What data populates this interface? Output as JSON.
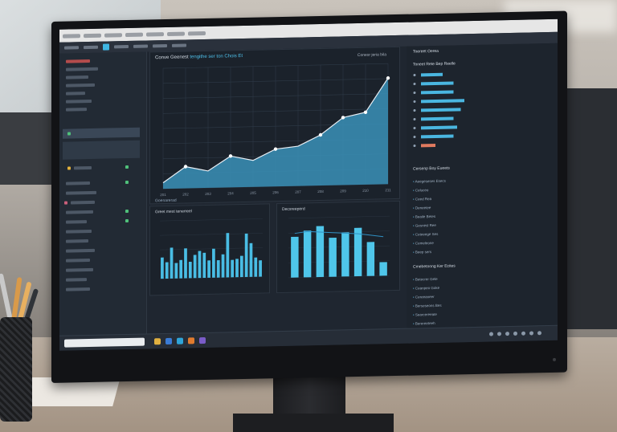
{
  "scene": "Desktop monitor in an office displaying an analytics dashboard",
  "colors": {
    "accent": "#3fb6e2",
    "area_fill": "#3a90b8",
    "panel_bg": "#1b222b",
    "screen_bg": "#1f2630"
  },
  "main_chart": {
    "title_prefix": "Conve Geenest",
    "title_highlight": "tengithe ser ton Chois Et",
    "subtitle": "Conesr jeria bila",
    "x_ticks": [
      "201",
      "202",
      "203",
      "204",
      "205",
      "206",
      "207",
      "208",
      "209",
      "210",
      "211"
    ]
  },
  "bottom_left": {
    "section_label": "Goenarerad",
    "title": "Greet mest tenerreel"
  },
  "bottom_right": {
    "title": "Decsreeperd"
  },
  "right_panel": {
    "title": "Toereet Oerea",
    "subtitle": "Toneet Rete Bep Reelle",
    "list_title": "Cersenp Boy Eueets",
    "list": [
      "Aeegeseses Esecs",
      "Celuceo",
      "Ceed Rea",
      "Deneetee",
      "Beaile Betes",
      "Gesnesl Ree",
      "Ceteeege Ses",
      "Cemeleone",
      "Beep sers"
    ],
    "list2_title": "Cmebetnong Ker Ecites",
    "list2": [
      "Betecrer Gele",
      "Ceanpeo Goke",
      "Cereeaneer",
      "Berseseons Bes",
      "Searcereeate",
      "Berereeteeh"
    ]
  },
  "chart_data": [
    {
      "type": "area",
      "x": [
        "201",
        "202",
        "203",
        "204",
        "205",
        "206",
        "207",
        "208",
        "209",
        "210",
        "211"
      ],
      "series": [
        {
          "values": [
            5,
            18,
            14,
            26,
            22,
            31,
            33,
            42,
            56,
            60,
            88
          ]
        }
      ],
      "markers_at": [
        1,
        3,
        5,
        7,
        8,
        9,
        10
      ],
      "ylim": [
        0,
        100
      ],
      "grid": true
    },
    {
      "type": "bar",
      "values": [
        22,
        17,
        32,
        16,
        19,
        31,
        17,
        24,
        28,
        26,
        18,
        30,
        18,
        24,
        46,
        18,
        19,
        22,
        45,
        35,
        20,
        17
      ],
      "ylim": [
        0,
        60
      ]
    },
    {
      "type": "bar",
      "values": [
        48,
        55,
        60,
        46,
        52,
        57,
        40,
        16
      ],
      "ylim": [
        0,
        70
      ],
      "overlay_line": [
        52,
        54,
        53,
        52,
        51,
        50,
        48,
        46
      ]
    },
    {
      "type": "bar",
      "orientation": "horizontal",
      "values": [
        0.3,
        0.45,
        0.45,
        0.6,
        0.55,
        0.45,
        0.5,
        0.45,
        0.2
      ],
      "xlim": [
        0,
        1
      ]
    }
  ]
}
